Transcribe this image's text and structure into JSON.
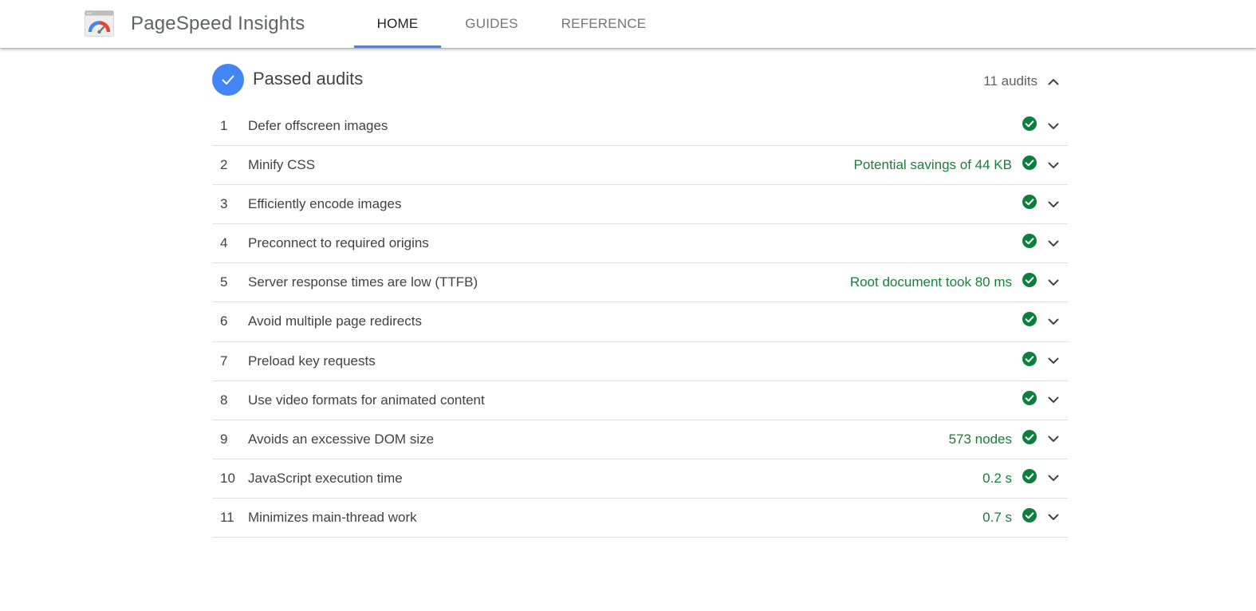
{
  "header": {
    "app_title": "PageSpeed Insights",
    "logo_icon": "pagespeed-gauge-logo",
    "tabs": [
      {
        "label": "HOME",
        "active": true
      },
      {
        "label": "GUIDES",
        "active": false
      },
      {
        "label": "REFERENCE",
        "active": false
      }
    ]
  },
  "section": {
    "title": "Passed audits",
    "count_label": "11 audits",
    "badge_icon": "checkmark-icon",
    "toggle_icon": "chevron-up-icon",
    "expanded": true
  },
  "audits": [
    {
      "num": "1",
      "title": "Defer offscreen images",
      "value": ""
    },
    {
      "num": "2",
      "title": "Minify CSS",
      "value": "Potential savings of 44 KB"
    },
    {
      "num": "3",
      "title": "Efficiently encode images",
      "value": ""
    },
    {
      "num": "4",
      "title": "Preconnect to required origins",
      "value": ""
    },
    {
      "num": "5",
      "title": "Server response times are low (TTFB)",
      "value": "Root document took 80 ms"
    },
    {
      "num": "6",
      "title": "Avoid multiple page redirects",
      "value": ""
    },
    {
      "num": "7",
      "title": "Preload key requests",
      "value": ""
    },
    {
      "num": "8",
      "title": "Use video formats for animated content",
      "value": ""
    },
    {
      "num": "9",
      "title": "Avoids an excessive DOM size",
      "value": "573 nodes"
    },
    {
      "num": "10",
      "title": "JavaScript execution time",
      "value": "0.2 s"
    },
    {
      "num": "11",
      "title": "Minimizes main-thread work",
      "value": "0.7 s"
    }
  ],
  "colors": {
    "accent": "#4285f4",
    "pass_green": "#188038",
    "pass_icon": "#0d7f3c"
  }
}
